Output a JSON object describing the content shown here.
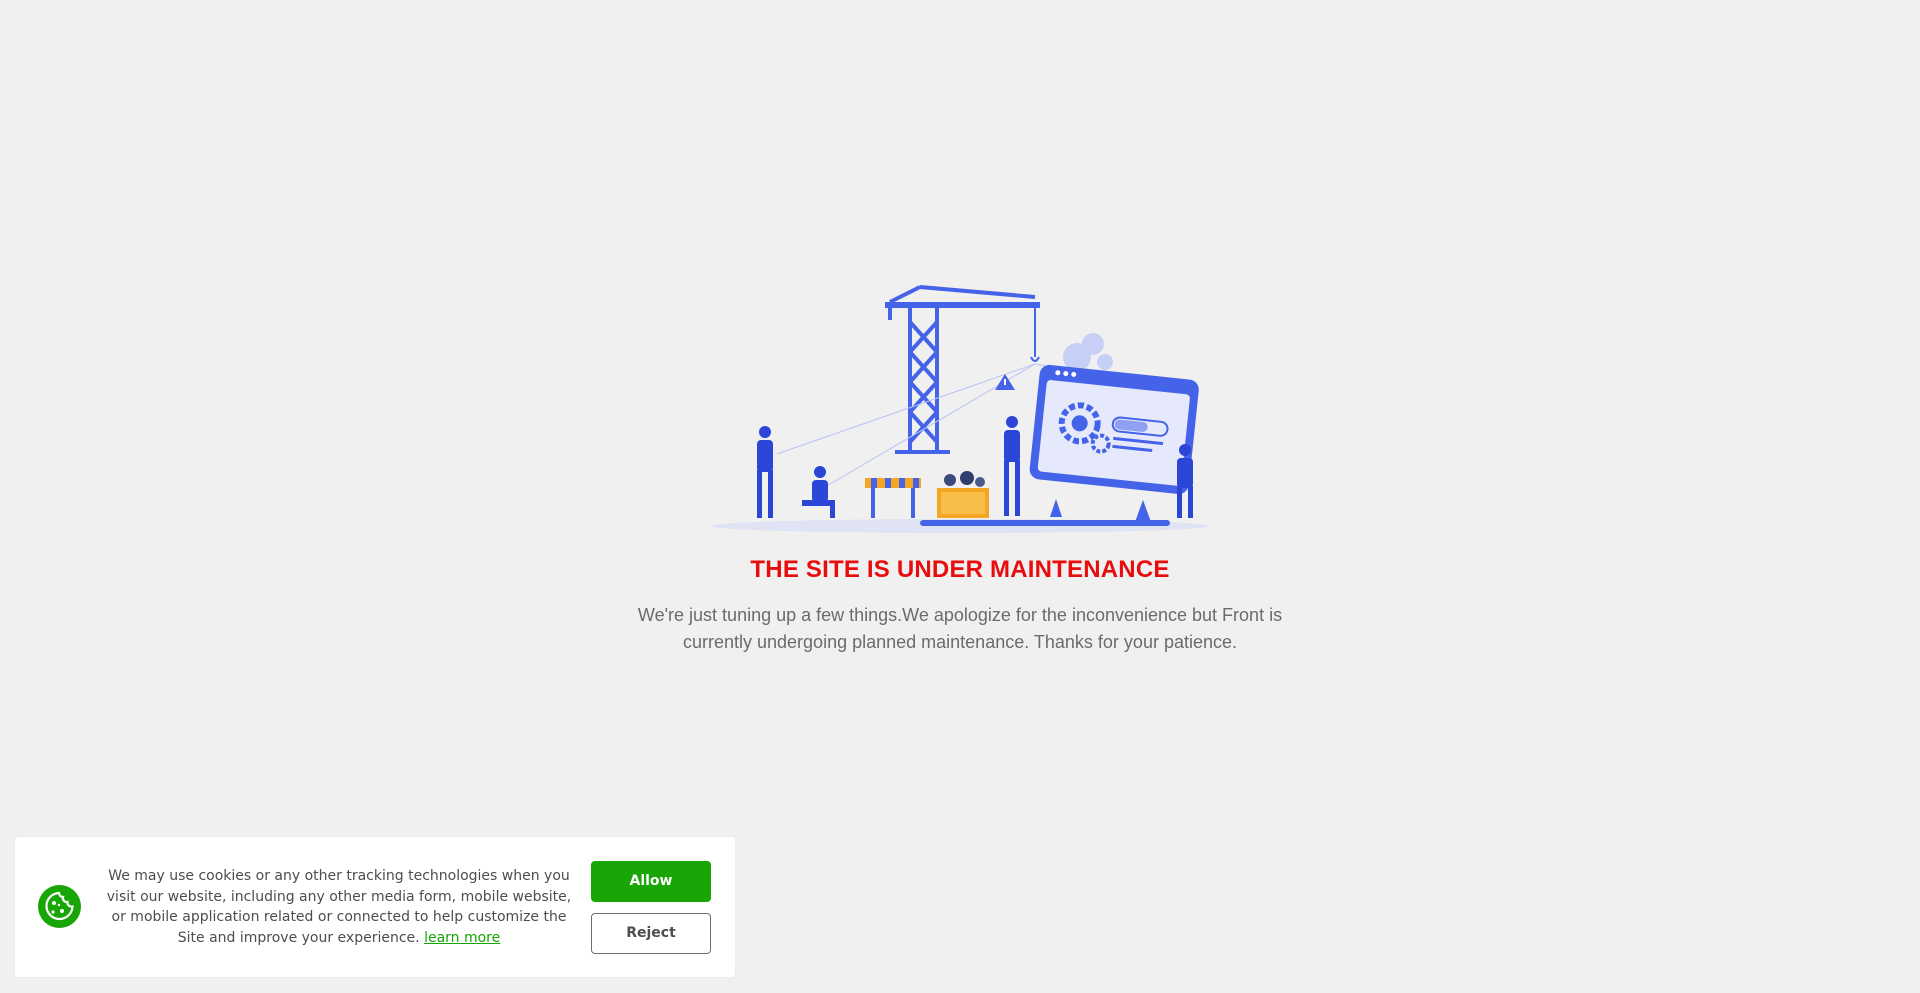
{
  "maintenance": {
    "title": "THE SITE IS UNDER MAINTENANCE",
    "description": "We're just tuning up a few things.We apologize for the inconvenience but Front is currently undergoing planned maintenance. Thanks for your patience."
  },
  "cookie_banner": {
    "message": "We may use cookies or any other tracking technologies when you visit our website, including any other media form, mobile website, or mobile application related or connected to help customize the Site and improve your experience. ",
    "learn_more_label": "learn more",
    "allow_label": "Allow",
    "reject_label": "Reject",
    "icon": "cookie-icon"
  },
  "colors": {
    "background": "#f0f0f0",
    "title_red": "#e80c0c",
    "accent_green": "#17a606",
    "illustration_blue": "#4563e8"
  }
}
